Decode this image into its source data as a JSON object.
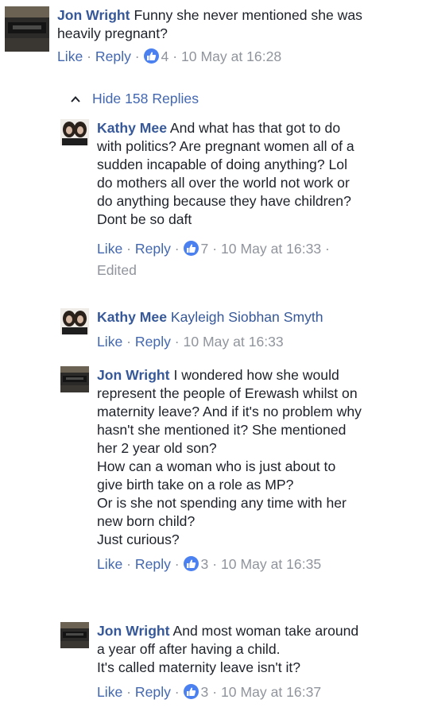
{
  "comments": [
    {
      "author": "Jon Wright",
      "text_lines": [
        "Funny she never mentioned she was",
        "heavily pregnant?"
      ],
      "like": "Like",
      "reply": "Reply",
      "reactions": "4",
      "time": "10 May at 16:28"
    }
  ],
  "toggle": {
    "label": "Hide 158 Replies"
  },
  "replies": [
    {
      "author": "Kathy Mee",
      "text_lines": [
        "And what has that got to do",
        "with politics? Are pregnant women all of a",
        "sudden incapable of doing anything? Lol",
        "do mothers all over the world not work or",
        "do anything because they have children?",
        "Dont be so daft"
      ],
      "like": "Like",
      "reply": "Reply",
      "reactions": "7",
      "time": "10 May at 16:33",
      "edited": "Edited"
    },
    {
      "author": "Kathy Mee",
      "mention": "Kayleigh Siobhan Smyth",
      "like": "Like",
      "reply": "Reply",
      "time": "10 May at 16:33"
    },
    {
      "author": "Jon Wright",
      "text_lines": [
        "I wondered how she would",
        "represent the people of Erewash whilst on",
        "maternity leave? And if it's no problem why",
        "hasn't she mentioned it? She mentioned",
        "her 2 year old son?",
        "How can a woman who is just about to",
        "give birth take on a role as MP?",
        "Or is she not spending any time with her",
        "new born child?",
        "Just curious?"
      ],
      "like": "Like",
      "reply": "Reply",
      "reactions": "3",
      "time": "10 May at 16:35"
    },
    {
      "author": "Jon Wright",
      "text_lines": [
        "And most woman take around",
        "a year off after having a child.",
        "It's called maternity leave isn't it?"
      ],
      "like": "Like",
      "reply": "Reply",
      "reactions": "3",
      "time": "10 May at 16:37"
    }
  ],
  "separator": "·",
  "colors": {
    "name_link": "#365899",
    "action_link": "#4267b2",
    "meta_gray": "#90949c",
    "like_badge": "#4a80f0",
    "text": "#1d2129"
  },
  "icons": {
    "toggle": "chevron-up-icon",
    "reaction": "thumbs-up-icon"
  }
}
